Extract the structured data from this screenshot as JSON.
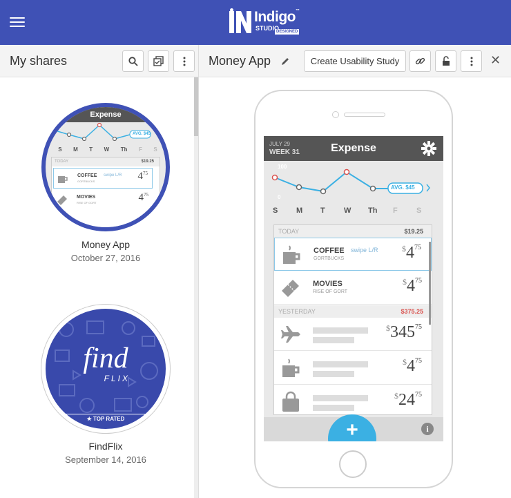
{
  "header": {
    "logo_main": "Indigo",
    "logo_tm": "™",
    "logo_studio": "STUDIO",
    "logo_designed": "DESIGNED"
  },
  "left": {
    "title": "My shares",
    "shares": [
      {
        "name": "Money App",
        "date": "October 27, 2016"
      },
      {
        "name": "FindFlix",
        "date": "September 14, 2016"
      }
    ]
  },
  "right": {
    "title": "Money App",
    "usability_label": "Create Usability Study"
  },
  "app": {
    "date_line1": "JULY 29",
    "date_line2": "WEEK 31",
    "title": "Expense",
    "chart_max": "100",
    "chart_min": "0",
    "avg_label": "AVG. $45",
    "days": [
      "S",
      "M",
      "T",
      "W",
      "Th",
      "F",
      "S"
    ],
    "today_label": "TODAY",
    "today_total": "$19.25",
    "yesterday_label": "YESTERDAY",
    "yesterday_total": "$375.25",
    "items": [
      {
        "name": "COFFEE",
        "sub": "GORTBUCKS",
        "swipe": "swipe L/R",
        "currency": "$",
        "dollars": "4",
        "cents": "75"
      },
      {
        "name": "MOVIES",
        "sub": "RISE OF GORT",
        "currency": "$",
        "dollars": "4",
        "cents": "75"
      },
      {
        "currency": "$",
        "dollars": "345",
        "cents": "75"
      },
      {
        "currency": "$",
        "dollars": "4",
        "cents": "75"
      },
      {
        "currency": "$",
        "dollars": "24",
        "cents": "75"
      }
    ],
    "fab_label": "+",
    "info_label": "i"
  },
  "thumb1": {
    "title": "Expense",
    "avg_label": "AVG. $45",
    "days": [
      "S",
      "M",
      "T",
      "W",
      "Th",
      "F",
      "S"
    ],
    "today_label": "TODAY",
    "today_total": "$19.25",
    "item1_name": "COFFEE",
    "item1_sub": "GORTBUCKS",
    "item1_swipe": "swipe L/R",
    "item1_price": "4",
    "item1_cents": "75",
    "item2_name": "MOVIES",
    "item2_sub": "RISE OF GORT",
    "item2_price": "4",
    "item2_cents": "75"
  },
  "thumb2": {
    "word1": "find",
    "word2": "FLIX",
    "badge": "TOP RATED"
  },
  "colors": {
    "header": "#3f51b5",
    "accent": "#3bb0e3",
    "negative": "#d9534f"
  }
}
